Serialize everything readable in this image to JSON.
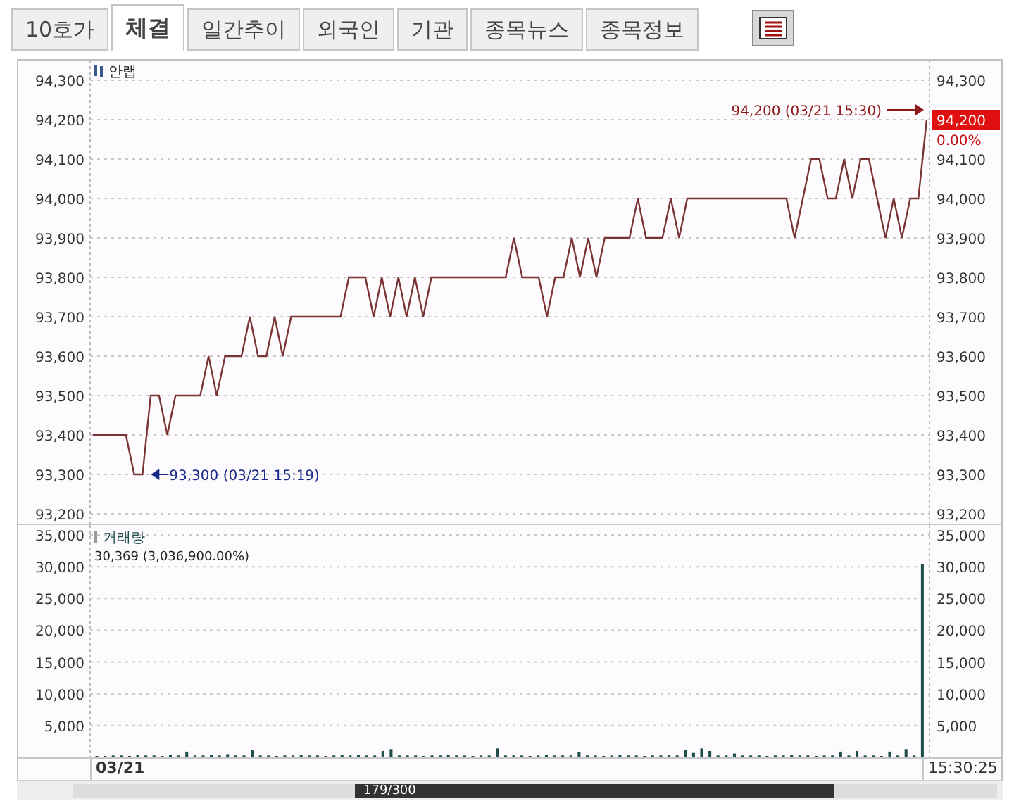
{
  "tabs": [
    {
      "label": "10호가",
      "selected": false
    },
    {
      "label": "체결",
      "selected": true
    },
    {
      "label": "일간추이",
      "selected": false
    },
    {
      "label": "외국인",
      "selected": false
    },
    {
      "label": "기관",
      "selected": false
    },
    {
      "label": "종목뉴스",
      "selected": false
    },
    {
      "label": "종목정보",
      "selected": false
    }
  ],
  "price_pane": {
    "last_price_tag": "94,200",
    "change": "0.00%",
    "chart_data": {
      "type": "line",
      "grid": true,
      "ylim": [
        93200,
        94300
      ],
      "yticks": [
        {
          "value": 93200,
          "label": "93,200"
        },
        {
          "value": 93300,
          "label": "93,300"
        },
        {
          "value": 93400,
          "label": "93,400"
        },
        {
          "value": 93500,
          "label": "93,500"
        },
        {
          "value": 93600,
          "label": "93,600"
        },
        {
          "value": 93700,
          "label": "93,700"
        },
        {
          "value": 93800,
          "label": "93,800"
        },
        {
          "value": 93900,
          "label": "93,900"
        },
        {
          "value": 94000,
          "label": "94,000"
        },
        {
          "value": 94100,
          "label": "94,100"
        },
        {
          "value": 94200,
          "label": "94,200"
        },
        {
          "value": 94300,
          "label": "94,300"
        }
      ],
      "series": [
        {
          "name": "안랩",
          "color": "#7a3434",
          "values": [
            93400,
            93400,
            93400,
            93400,
            93400,
            93300,
            93300,
            93500,
            93500,
            93400,
            93500,
            93500,
            93500,
            93500,
            93600,
            93500,
            93600,
            93600,
            93600,
            93700,
            93600,
            93600,
            93700,
            93600,
            93700,
            93700,
            93700,
            93700,
            93700,
            93700,
            93700,
            93800,
            93800,
            93800,
            93700,
            93800,
            93700,
            93800,
            93700,
            93800,
            93700,
            93800,
            93800,
            93800,
            93800,
            93800,
            93800,
            93800,
            93800,
            93800,
            93800,
            93900,
            93800,
            93800,
            93800,
            93700,
            93800,
            93800,
            93900,
            93800,
            93900,
            93800,
            93900,
            93900,
            93900,
            93900,
            94000,
            93900,
            93900,
            93900,
            94000,
            93900,
            94000,
            94000,
            94000,
            94000,
            94000,
            94000,
            94000,
            94000,
            94000,
            94000,
            94000,
            94000,
            94000,
            93900,
            94000,
            94100,
            94100,
            94000,
            94000,
            94100,
            94000,
            94100,
            94100,
            94000,
            93900,
            94000,
            93900,
            94000,
            94000,
            94200
          ]
        }
      ],
      "annotations": [
        "94,200 (03/21 15:30)",
        "93,300 (03/21 15:19)"
      ]
    }
  },
  "volume_pane": {
    "readout": "30,369 (3,036,900.00%)",
    "chart_data": {
      "type": "bar",
      "grid": true,
      "ylim": [
        0,
        35000
      ],
      "yticks": [
        {
          "value": 5000,
          "label": "5,000"
        },
        {
          "value": 10000,
          "label": "10,000"
        },
        {
          "value": 15000,
          "label": "15,000"
        },
        {
          "value": 20000,
          "label": "20,000"
        },
        {
          "value": 25000,
          "label": "25,000"
        },
        {
          "value": 30000,
          "label": "30,000"
        },
        {
          "value": 35000,
          "label": "35,000"
        }
      ],
      "series": [
        {
          "name": "거래량",
          "color": "#1f4f4c",
          "values": [
            200,
            200,
            300,
            300,
            200,
            400,
            300,
            300,
            200,
            400,
            300,
            900,
            300,
            300,
            400,
            300,
            500,
            300,
            300,
            1100,
            300,
            300,
            200,
            300,
            300,
            400,
            300,
            300,
            200,
            300,
            400,
            300,
            400,
            300,
            300,
            1000,
            1300,
            300,
            300,
            300,
            200,
            300,
            300,
            400,
            300,
            300,
            200,
            300,
            300,
            1400,
            300,
            300,
            300,
            200,
            300,
            400,
            300,
            300,
            300,
            800,
            300,
            300,
            200,
            300,
            400,
            300,
            300,
            200,
            300,
            300,
            400,
            300,
            1200,
            700,
            1400,
            1000,
            300,
            300,
            600,
            300,
            300,
            300,
            200,
            300,
            300,
            400,
            300,
            300,
            200,
            300,
            300,
            900,
            300,
            1000,
            300,
            300,
            200,
            900,
            300,
            1300,
            300,
            30400
          ]
        }
      ]
    }
  },
  "x_axis": {
    "date": "03/21",
    "time": "15:30:25"
  },
  "scrollbar": {
    "position": "179/300"
  }
}
